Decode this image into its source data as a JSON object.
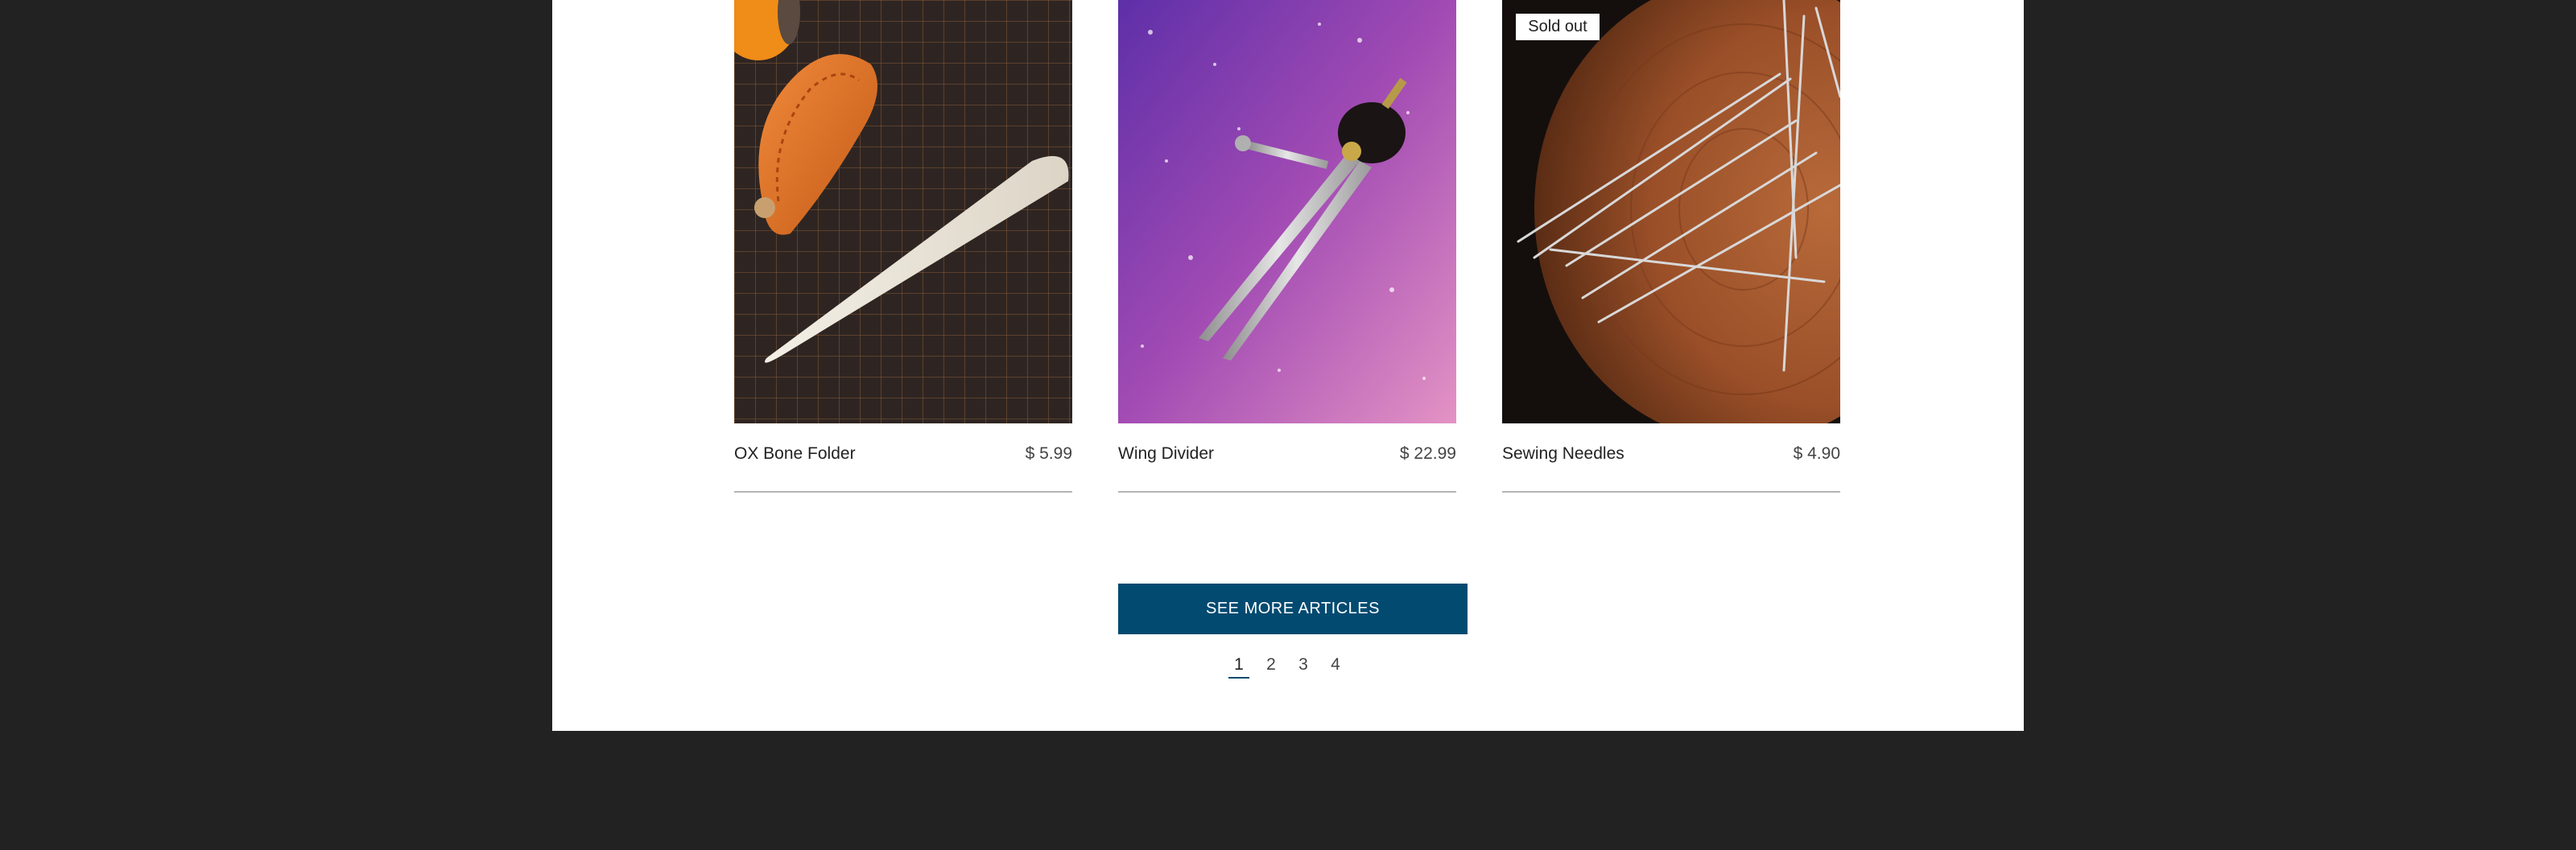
{
  "products": [
    {
      "name": "OX Bone Folder",
      "price": "$ 5.99",
      "image": "bone-folder-on-cutting-mat"
    },
    {
      "name": "Wing Divider",
      "price": "$ 22.99",
      "image": "wing-divider-on-purple-glitter"
    },
    {
      "name": "Sewing Needles",
      "price": "$ 4.90",
      "image": "needles-on-wood-slice",
      "badge": "Sold out"
    }
  ],
  "see_more_label": "SEE MORE ARTICLES",
  "pagination": {
    "pages": [
      "1",
      "2",
      "3",
      "4"
    ],
    "current": "1"
  },
  "colors": {
    "background": "#222222",
    "content": "#ffffff",
    "button": "#034a70"
  }
}
